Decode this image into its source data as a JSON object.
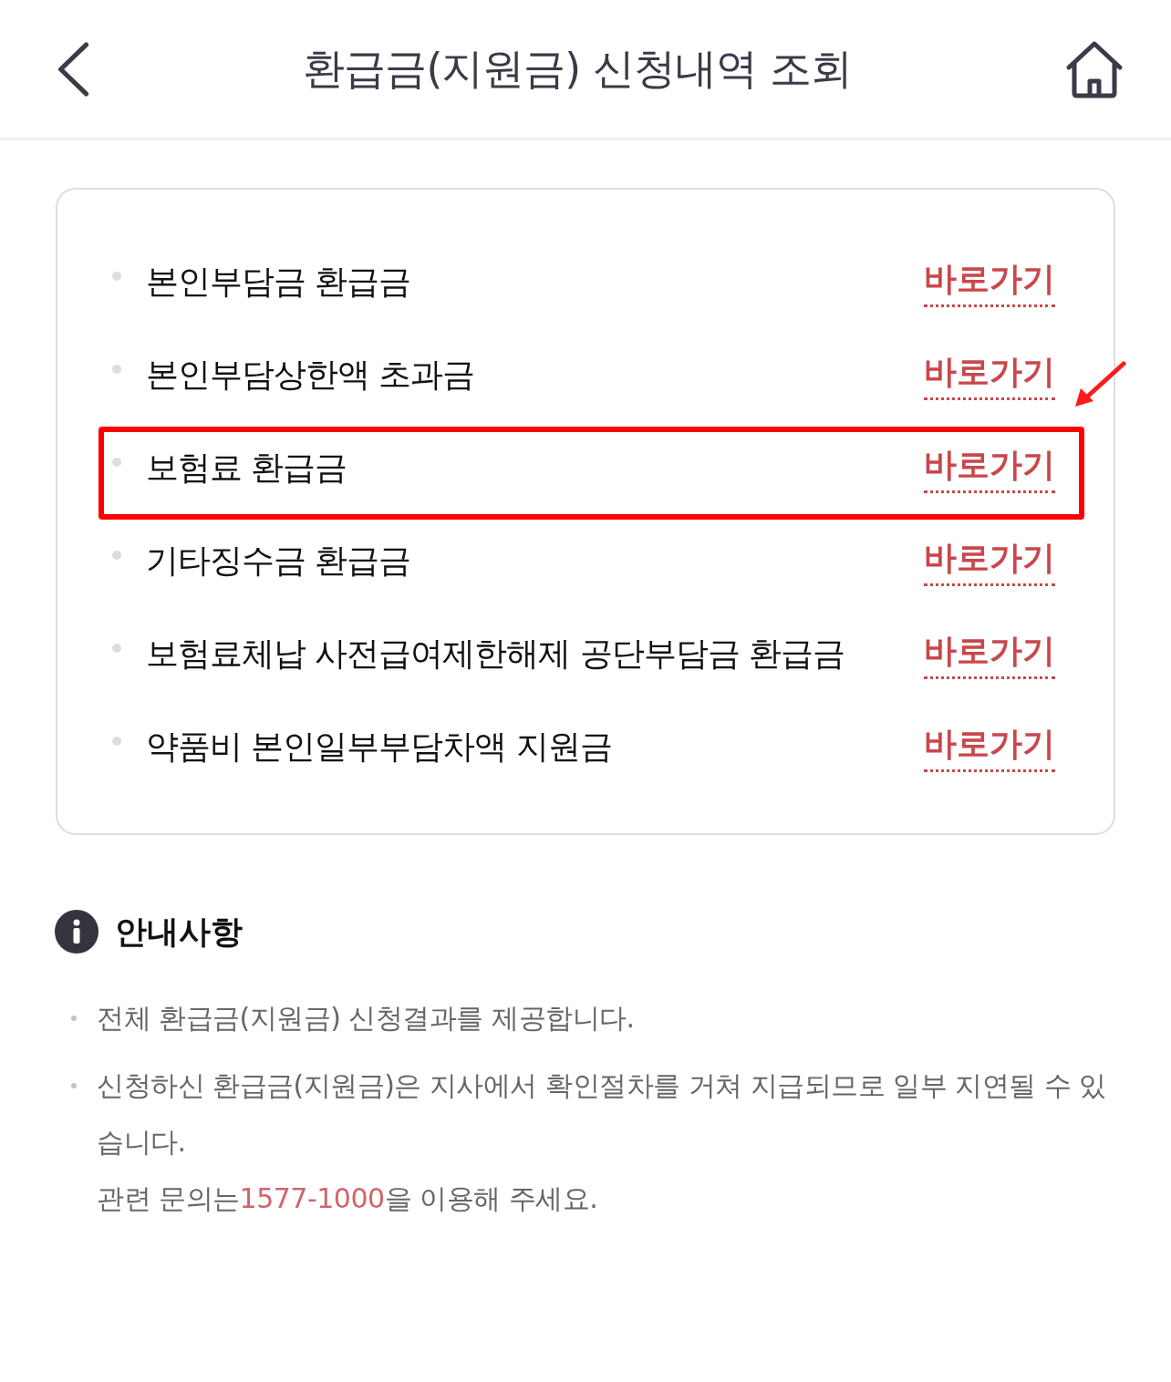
{
  "header": {
    "title": "환급금(지원금) 신청내역 조회"
  },
  "items": [
    {
      "label": "본인부담금 환급금",
      "link": "바로가기",
      "highlighted": false
    },
    {
      "label": "본인부담상한액 초과금",
      "link": "바로가기",
      "highlighted": false
    },
    {
      "label": "보험료 환급금",
      "link": "바로가기",
      "highlighted": true
    },
    {
      "label": "기타징수금 환급금",
      "link": "바로가기",
      "highlighted": false
    },
    {
      "label": "보험료체납 사전급여제한해제 공단부담금 환급금",
      "link": "바로가기",
      "highlighted": false
    },
    {
      "label": "약품비 본인일부부담차액 지원금",
      "link": "바로가기",
      "highlighted": false
    }
  ],
  "notice": {
    "title": "안내사항",
    "notes": [
      {
        "text": "전체 환급금(지원금) 신청결과를 제공합니다."
      },
      {
        "text": "신청하신 환급금(지원금)은 지사에서 확인절차를 거쳐 지급되므로 일부 지연될 수 있습니다.",
        "contact": {
          "before": "관련 문의는",
          "phone": "1577-1000",
          "after": "을 이용해 주세요."
        }
      }
    ]
  }
}
